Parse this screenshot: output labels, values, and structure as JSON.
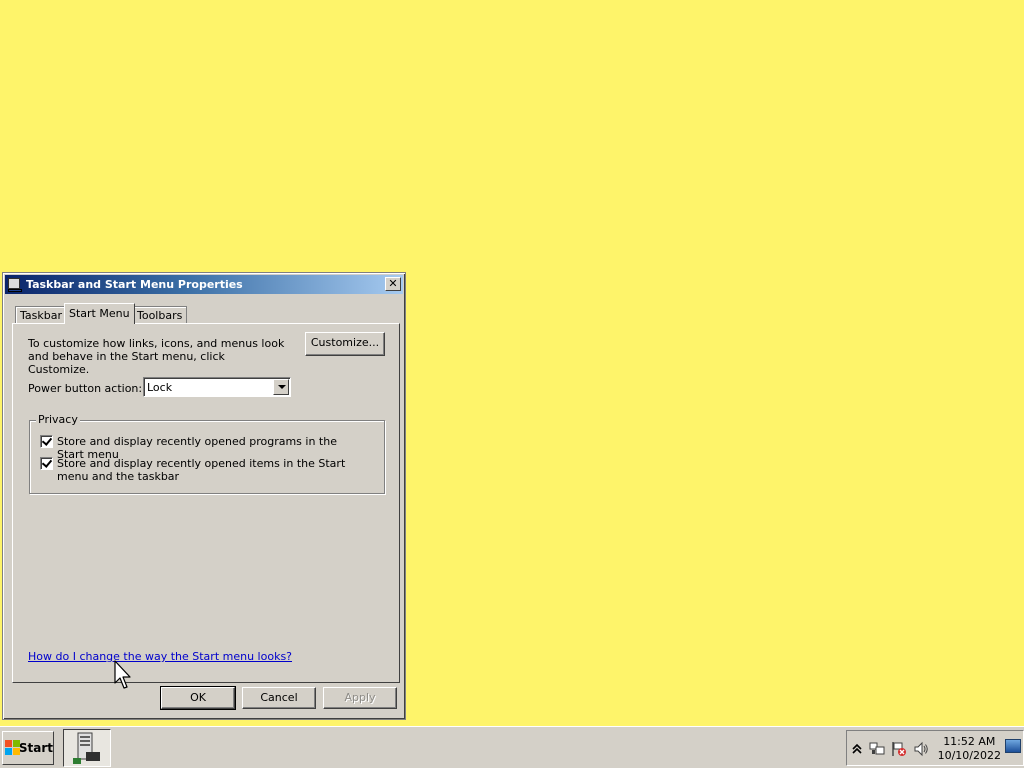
{
  "dialog": {
    "title": "Taskbar and Start Menu Properties",
    "close_label": "✕",
    "tabs": [
      {
        "label": "Taskbar",
        "active": false
      },
      {
        "label": "Start Menu",
        "active": true
      },
      {
        "label": "Toolbars",
        "active": false
      }
    ],
    "description": "To customize how links, icons, and menus look and behave in the Start menu, click Customize.",
    "customize_label": "Customize...",
    "power_button_label": "Power button action:",
    "power_button_value": "Lock",
    "privacy": {
      "title": "Privacy",
      "options": [
        {
          "label": "Store and display recently opened programs in the Start menu",
          "checked": true
        },
        {
          "label": "Store and display recently opened items in the Start menu and the taskbar",
          "checked": true
        }
      ]
    },
    "help_link": "How do I change the way the Start menu looks?",
    "buttons": {
      "ok": "OK",
      "cancel": "Cancel",
      "apply": "Apply"
    }
  },
  "taskbar": {
    "start_label": "Start",
    "tray": {
      "icons": [
        "show-hidden-icons-chevron",
        "network-icon",
        "action-center-flag-icon",
        "volume-icon"
      ],
      "time": "11:52 AM",
      "date": "10/10/2022"
    }
  },
  "colors": {
    "desktop_background": "#fef46a",
    "window_face": "#d4d0c8",
    "title_gradient_start": "#0a246a",
    "title_gradient_end": "#a6caf0",
    "link": "#0000cc"
  }
}
